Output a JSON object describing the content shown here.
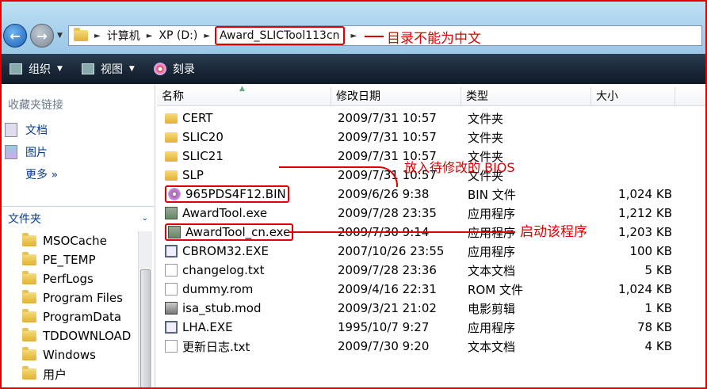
{
  "address": {
    "path": [
      "计算机",
      "XP (D:)",
      "Award_SLICTool113cn"
    ],
    "annotation": "目录不能为中文"
  },
  "toolbar": {
    "organize": "组织",
    "views": "视图",
    "burn": "刻录"
  },
  "left_pane": {
    "favorites_title": "收藏夹链接",
    "favorites": [
      "文档",
      "图片",
      "更多 »"
    ],
    "folders_title": "文件夹",
    "folders": [
      "MSOCache",
      "PE_TEMP",
      "PerfLogs",
      "Program Files",
      "ProgramData",
      "TDDOWNLOAD",
      "Windows",
      "用户"
    ]
  },
  "columns": {
    "name": "名称",
    "date": "修改日期",
    "type": "类型",
    "size": "大小"
  },
  "files": [
    {
      "name": "CERT",
      "date": "2009/7/31 10:57",
      "type": "文件夹",
      "size": "",
      "icon": "folder"
    },
    {
      "name": "SLIC20",
      "date": "2009/7/31 10:57",
      "type": "文件夹",
      "size": "",
      "icon": "folder"
    },
    {
      "name": "SLIC21",
      "date": "2009/7/31 10:57",
      "type": "文件夹",
      "size": "",
      "icon": "folder"
    },
    {
      "name": "SLP",
      "date": "2009/7/31 10:57",
      "type": "文件夹",
      "size": "",
      "icon": "folder"
    },
    {
      "name": "965PDS4F12.BIN",
      "date": "2009/6/26 9:38",
      "type": "BIN 文件",
      "size": "1,024 KB",
      "icon": "bin"
    },
    {
      "name": "AwardTool.exe",
      "date": "2009/7/28 23:35",
      "type": "应用程序",
      "size": "1,212 KB",
      "icon": "exe"
    },
    {
      "name": "AwardTool_cn.exe",
      "date": "2009/7/30 9:14",
      "type": "应用程序",
      "size": "1,203 KB",
      "icon": "exe"
    },
    {
      "name": "CBROM32.EXE",
      "date": "2007/10/26 23:55",
      "type": "应用程序",
      "size": "100 KB",
      "icon": "win"
    },
    {
      "name": "changelog.txt",
      "date": "2009/7/28 23:36",
      "type": "文本文档",
      "size": "5 KB",
      "icon": "txt"
    },
    {
      "name": "dummy.rom",
      "date": "2009/4/16 22:31",
      "type": "ROM 文件",
      "size": "1,024 KB",
      "icon": "txt"
    },
    {
      "name": "isa_stub.mod",
      "date": "2009/3/21 21:02",
      "type": "电影剪辑",
      "size": "1 KB",
      "icon": "mod"
    },
    {
      "name": "LHA.EXE",
      "date": "1995/10/7 9:27",
      "type": "应用程序",
      "size": "78 KB",
      "icon": "win"
    },
    {
      "name": "更新日志.txt",
      "date": "2009/7/30 9:20",
      "type": "文本文档",
      "size": "4 KB",
      "icon": "txt"
    }
  ],
  "annotations": {
    "bin_note": "放入待修改的 BIOS",
    "exe_note": "启动该程序"
  },
  "colors": {
    "annotation": "#e00000",
    "link": "#0b3c8c"
  }
}
